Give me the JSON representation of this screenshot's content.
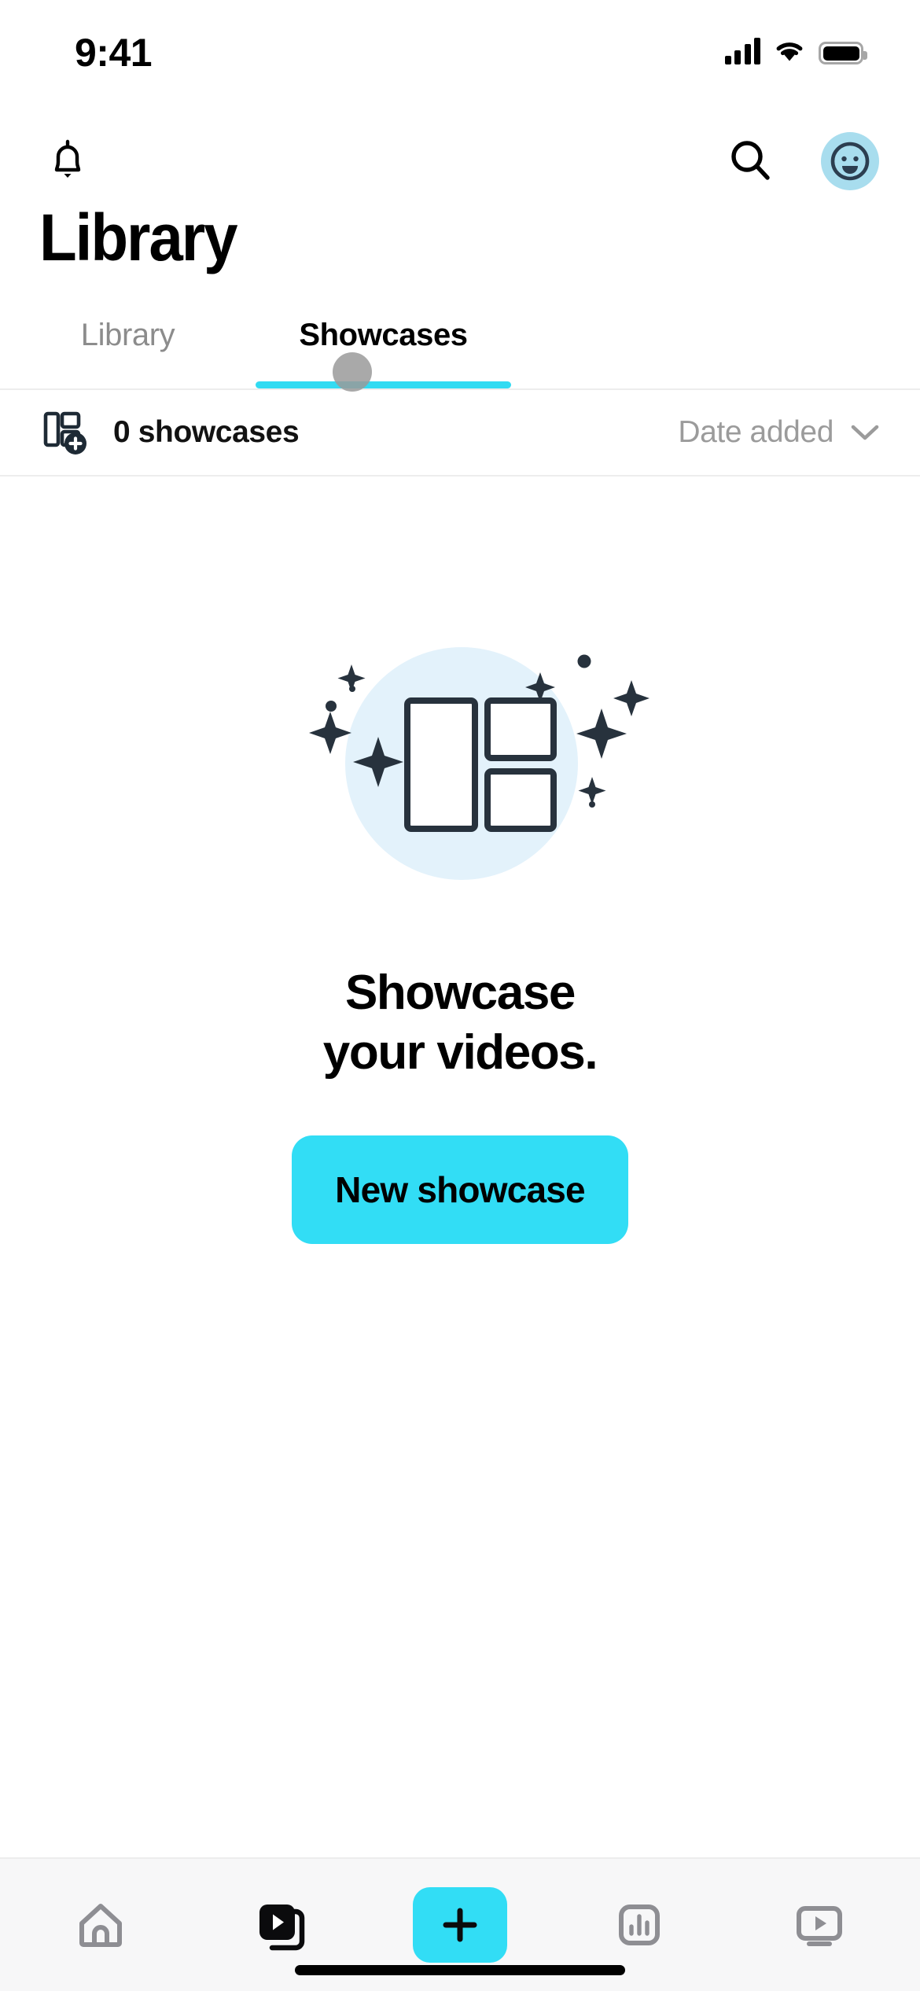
{
  "status_bar": {
    "time": "9:41",
    "cellular_icon": "cellular-signal-icon",
    "wifi_icon": "wifi-icon",
    "battery_icon": "battery-icon"
  },
  "app_bar": {
    "notifications_icon": "bell-icon",
    "search_icon": "search-icon",
    "avatar_icon": "smiley-avatar-icon",
    "avatar_bg": "#A8DDEE"
  },
  "header": {
    "title": "Library"
  },
  "tabs": {
    "items": [
      {
        "label": "Library",
        "active": false
      },
      {
        "label": "Showcases",
        "active": true
      }
    ],
    "active_color": "#32DBF2"
  },
  "filter_bar": {
    "add_icon": "add-showcase-icon",
    "count_label": "0 showcases",
    "sort_label": "Date added",
    "sort_chevron_icon": "chevron-down-icon"
  },
  "empty_state": {
    "illustration_icon": "showcase-grid-sparkle-illustration",
    "circle_color": "#E3F2FB",
    "line1": "Showcase",
    "line2": "your videos.",
    "cta_label": "New showcase",
    "cta_color": "#32DDF5"
  },
  "bottom_nav": {
    "items": [
      {
        "name": "home",
        "icon": "home-icon",
        "active": false
      },
      {
        "name": "library",
        "icon": "video-library-icon",
        "active": true
      },
      {
        "name": "create",
        "icon": "plus-icon",
        "active": false
      },
      {
        "name": "analytics",
        "icon": "bar-chart-icon",
        "active": false
      },
      {
        "name": "watch",
        "icon": "tv-play-icon",
        "active": false
      }
    ],
    "accent_color": "#32DDF5",
    "home_indicator": "home-indicator"
  }
}
